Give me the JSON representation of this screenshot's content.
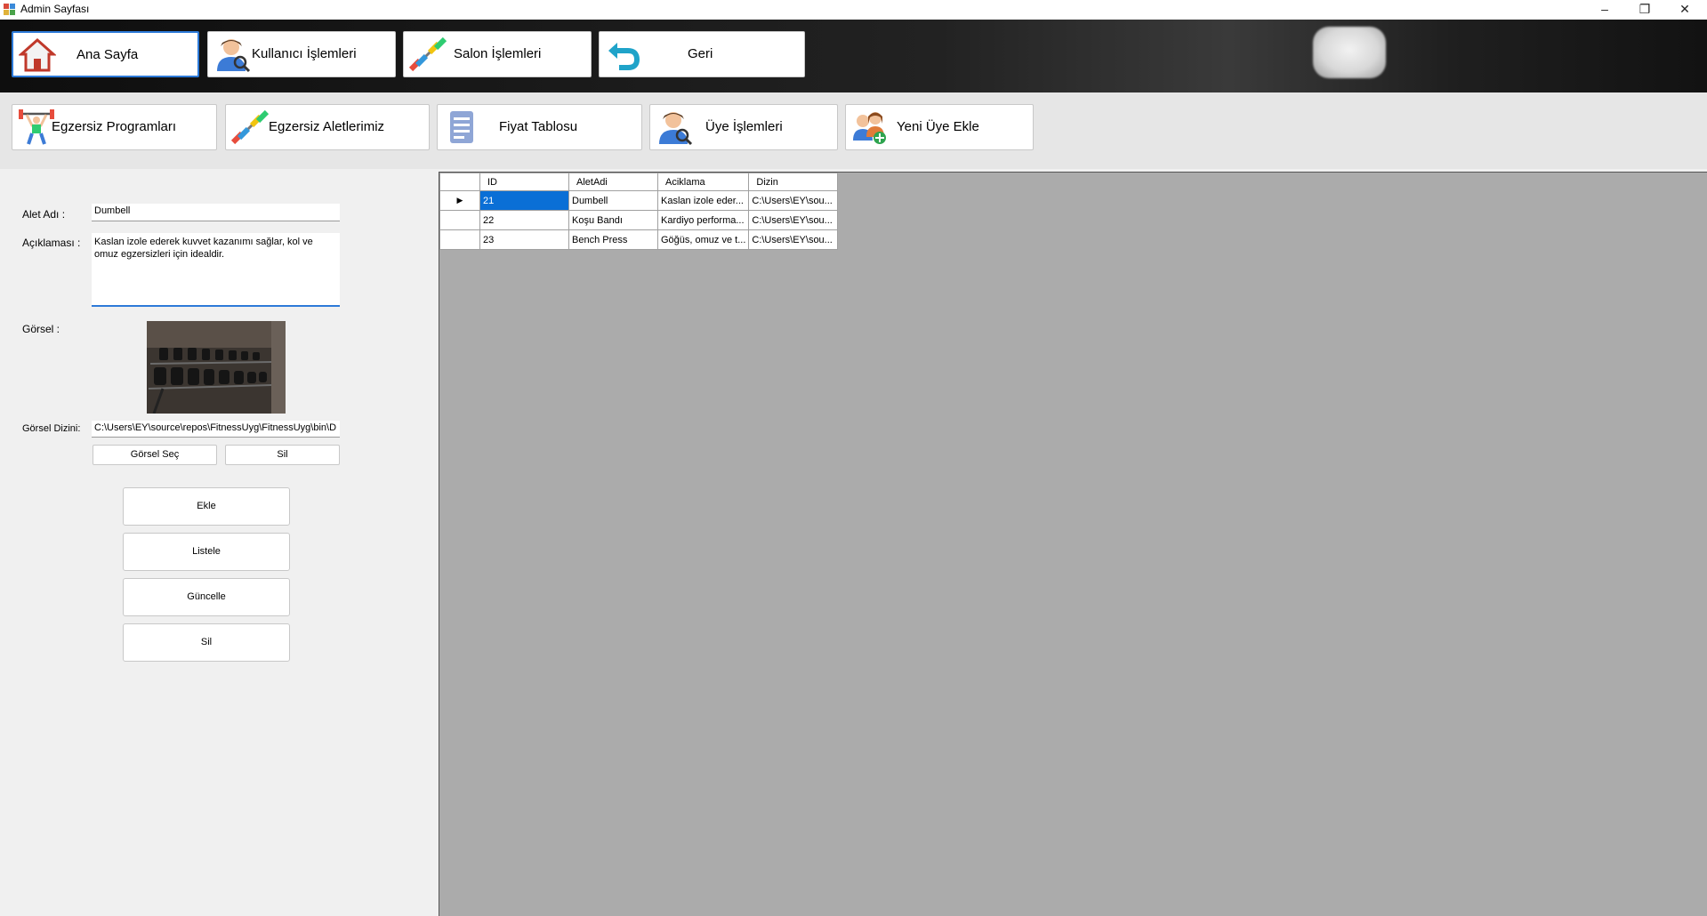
{
  "window": {
    "title": "Admin Sayfası"
  },
  "top_buttons": [
    {
      "label": "Ana Sayfa",
      "icon": "home-icon"
    },
    {
      "label": "Kullanıcı İşlemleri",
      "icon": "user-search-icon"
    },
    {
      "label": "Salon İşlemleri",
      "icon": "barbell-icon"
    },
    {
      "label": "Geri",
      "icon": "back-arrow-icon"
    }
  ],
  "second_buttons": [
    {
      "label": "Egzersiz Programları",
      "icon": "weightlifter-icon"
    },
    {
      "label": "Egzersiz Aletlerimiz",
      "icon": "barbell-icon"
    },
    {
      "label": "Fiyat Tablosu",
      "icon": "document-list-icon"
    },
    {
      "label": "Üye İşlemleri",
      "icon": "user-search-icon"
    },
    {
      "label": "Yeni Üye Ekle",
      "icon": "add-users-icon"
    }
  ],
  "form": {
    "alet_adi_label": "Alet Adı :",
    "alet_adi_value": "Dumbell",
    "aciklama_label": "Açıklaması :",
    "aciklama_value": "Kaslan izole ederek kuvvet kazanımı sağlar, kol ve omuz egzersizleri için idealdir.",
    "gorsel_label": "Görsel :",
    "gorsel_dizini_label": "Görsel Dizini:",
    "gorsel_dizini_value": "C:\\Users\\EY\\source\\repos\\FitnessUyg\\FitnessUyg\\bin\\D",
    "gorsel_sec_label": "Görsel Seç",
    "gorsel_sil_label": "Sil",
    "ekle_label": "Ekle",
    "listele_label": "Listele",
    "guncelle_label": "Güncelle",
    "sil_label": "Sil"
  },
  "grid": {
    "columns": [
      "ID",
      "AletAdi",
      "Aciklama",
      "Dizin"
    ],
    "rows": [
      [
        "21",
        "Dumbell",
        "Kaslan izole eder...",
        "C:\\Users\\EY\\sou..."
      ],
      [
        "22",
        "Koşu Bandı",
        "Kardiyo performa...",
        "C:\\Users\\EY\\sou..."
      ],
      [
        "23",
        "Bench Press",
        "Göğüs, omuz ve t...",
        "C:\\Users\\EY\\sou..."
      ]
    ],
    "selected_row": 0
  },
  "colors": {
    "accent": "#0a6fd6",
    "grid_background": "#ababab"
  }
}
